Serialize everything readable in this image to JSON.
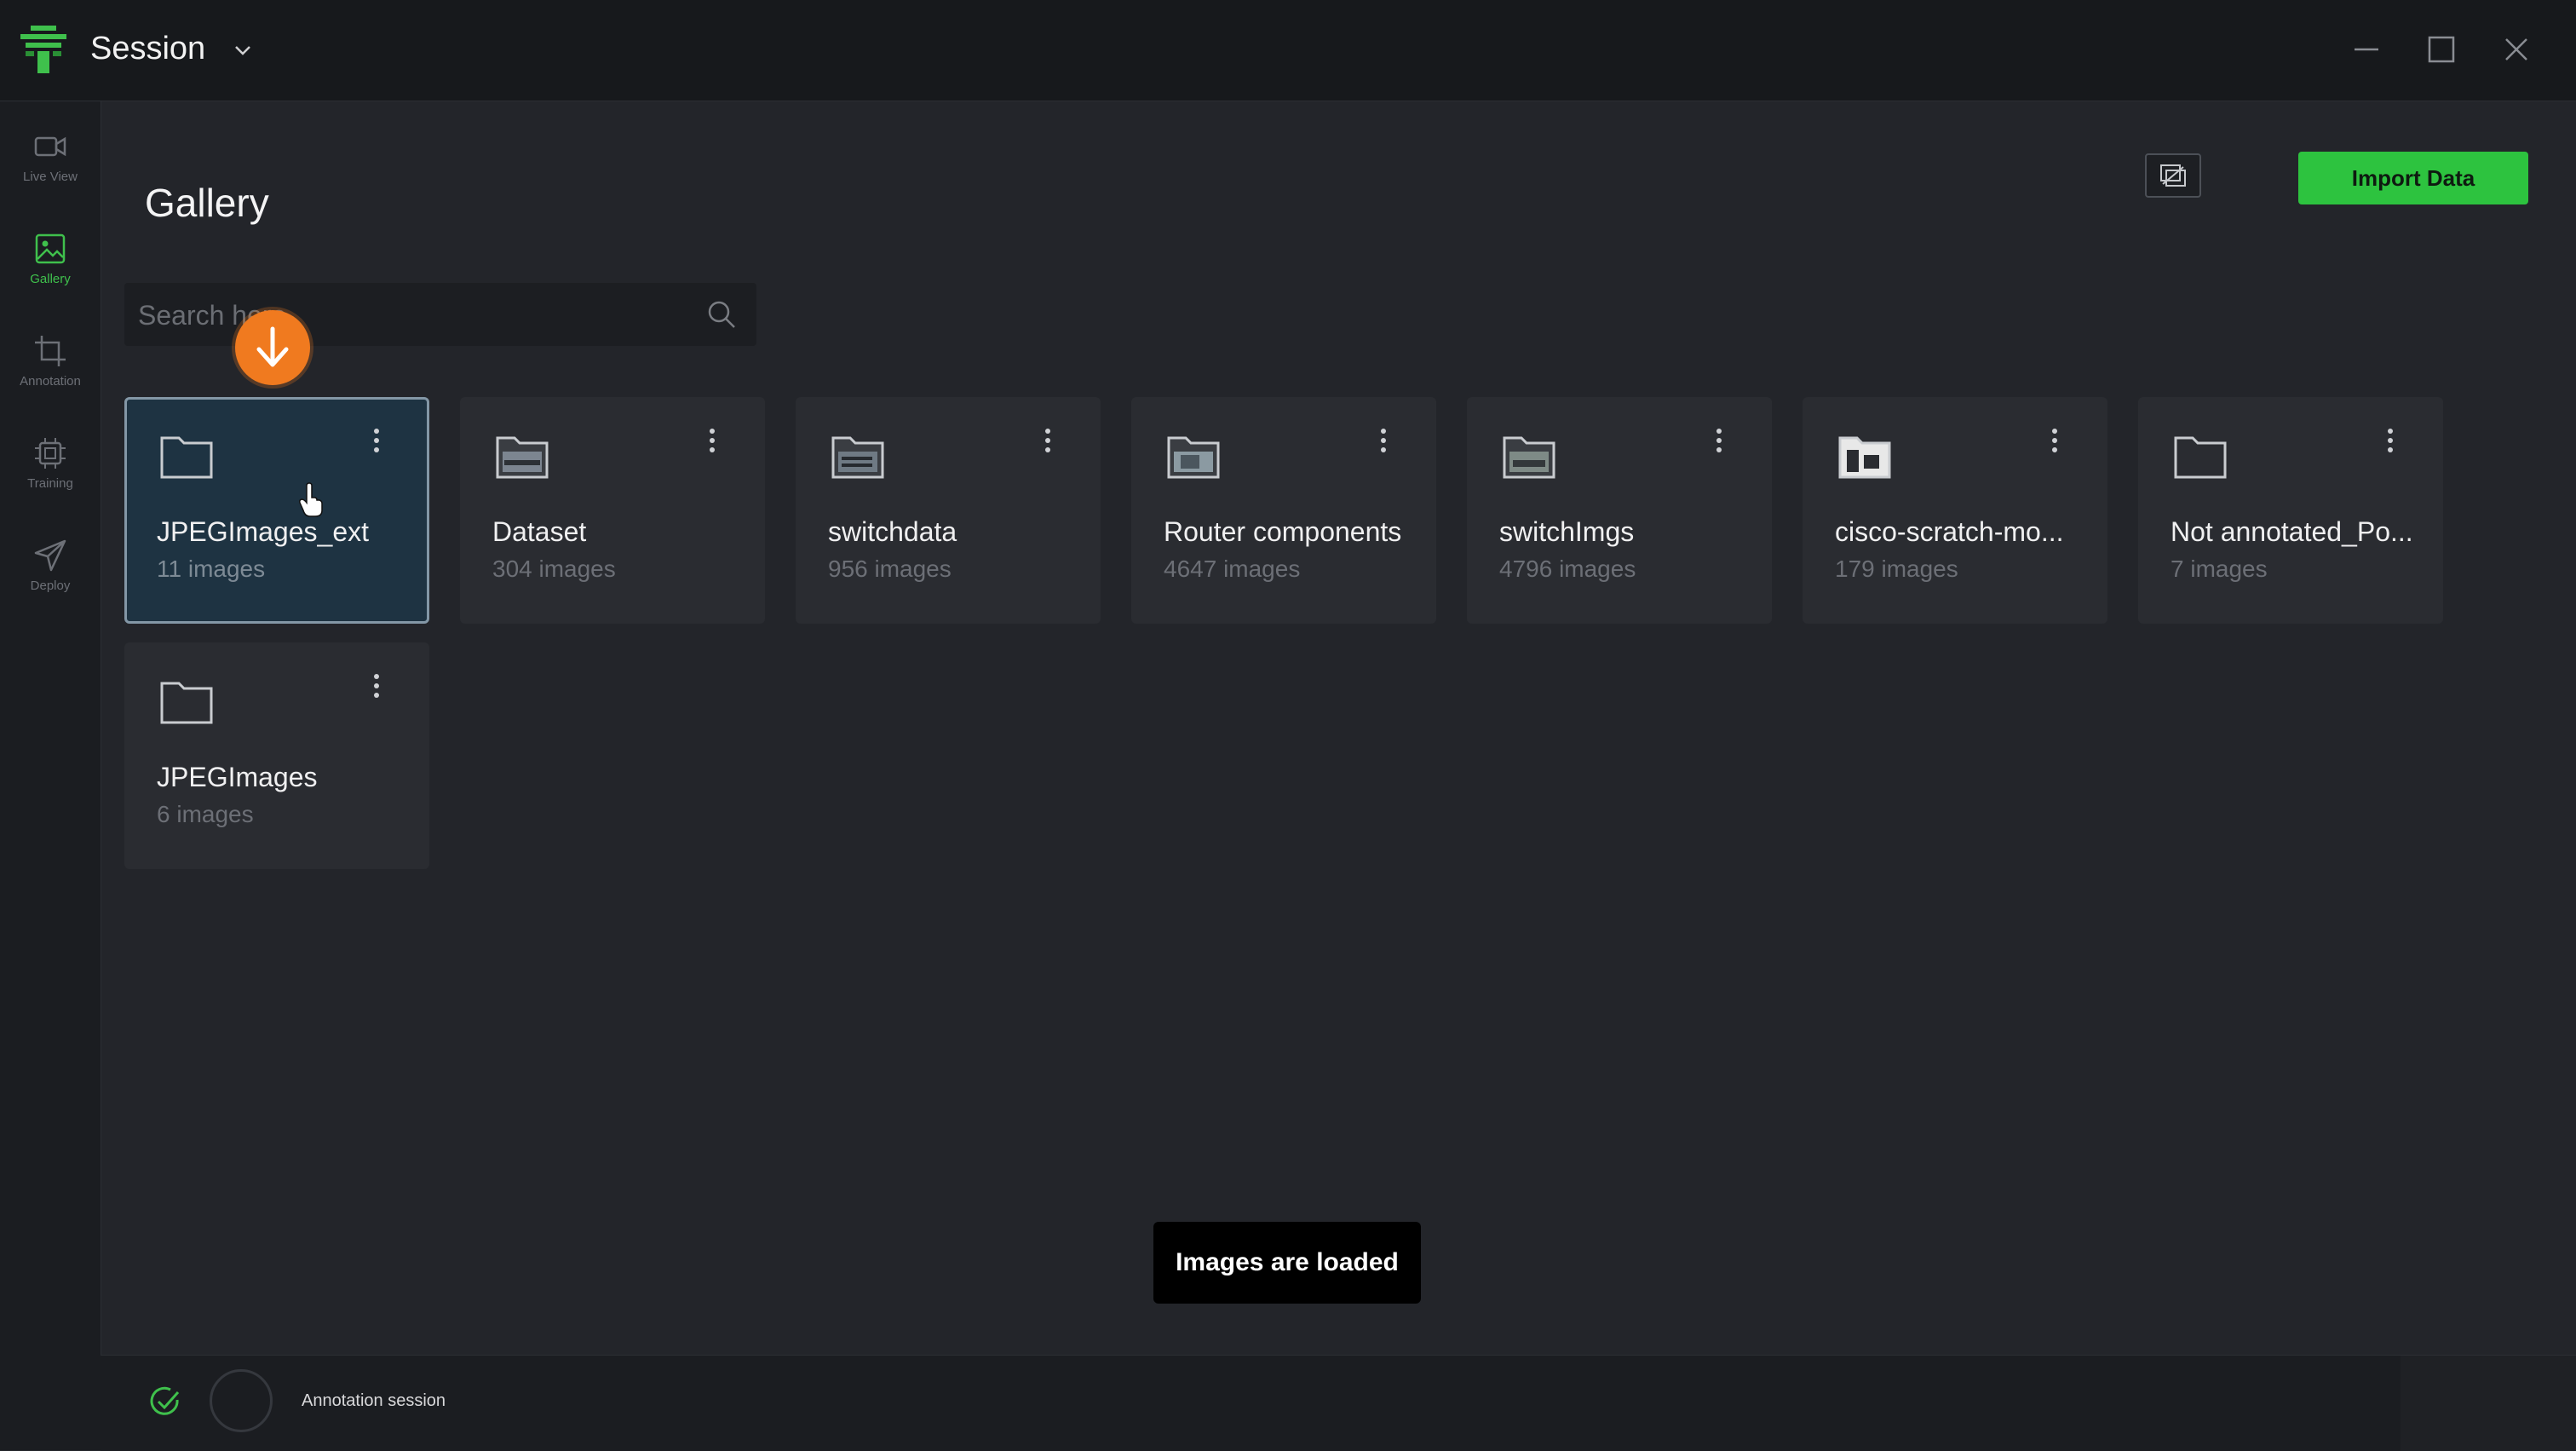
{
  "titlebar": {
    "session_label": "Session"
  },
  "sidebar": {
    "items": [
      {
        "label": "Live View",
        "icon": "video-camera-icon",
        "active": false
      },
      {
        "label": "Gallery",
        "icon": "image-icon",
        "active": true
      },
      {
        "label": "Annotation",
        "icon": "crop-icon",
        "active": false
      },
      {
        "label": "Training",
        "icon": "chip-icon",
        "active": false
      },
      {
        "label": "Deploy",
        "icon": "send-icon",
        "active": false
      }
    ]
  },
  "header": {
    "title": "Gallery",
    "import_label": "Import Data"
  },
  "search": {
    "placeholder": "Search here"
  },
  "folders": [
    {
      "name": "JPEGImages_ext",
      "count": "11 images",
      "selected": true,
      "thumbnail": "empty-folder-icon"
    },
    {
      "name": "Dataset",
      "count": "304 images",
      "selected": false,
      "thumbnail": "folder-preview-icon"
    },
    {
      "name": "switchdata",
      "count": "956 images",
      "selected": false,
      "thumbnail": "folder-preview-icon"
    },
    {
      "name": "Router components",
      "count": "4647 images",
      "selected": false,
      "thumbnail": "folder-preview-icon"
    },
    {
      "name": "switchImgs",
      "count": "4796 images",
      "selected": false,
      "thumbnail": "folder-preview-icon"
    },
    {
      "name": "cisco-scratch-mo...",
      "count": "179 images",
      "selected": false,
      "thumbnail": "folder-preview-icon"
    },
    {
      "name": "Not annotated_Po...",
      "count": "7 images",
      "selected": false,
      "thumbnail": "empty-folder-icon"
    },
    {
      "name": "JPEGImages",
      "count": "6 images",
      "selected": false,
      "thumbnail": "empty-folder-icon"
    }
  ],
  "toast": {
    "message": "Images are loaded"
  },
  "statusbar": {
    "label": "Annotation session"
  },
  "colors": {
    "accent": "#2dc33f",
    "marker": "#f07a1f",
    "selected_card": "#1e3342"
  }
}
